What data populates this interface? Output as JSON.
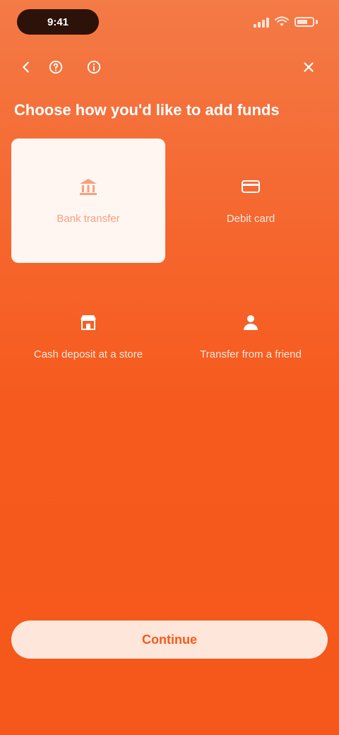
{
  "status_bar": {
    "time": "9:41"
  },
  "nav": {
    "back_icon": "back-arrow-icon",
    "help_icon": "help-icon",
    "close_icon": "close-icon"
  },
  "header": {
    "title": "Choose how you'd like to add funds"
  },
  "options": [
    {
      "label": "Bank transfer",
      "icon": "bank-icon",
      "selected": true
    },
    {
      "label": "Debit card",
      "icon": "card-icon",
      "selected": false
    },
    {
      "label": "Cash deposit at a store",
      "icon": "store-icon",
      "selected": false
    },
    {
      "label": "Transfer from a friend",
      "icon": "person-icon",
      "selected": false
    }
  ],
  "footer": {
    "continue_label": "Continue"
  },
  "colors": {
    "background_top": "#f47a46",
    "background_bottom": "#f5581a",
    "selected_card": "#fff6f1",
    "button_bg": "#ffe6da",
    "accent": "#f65a1d"
  }
}
